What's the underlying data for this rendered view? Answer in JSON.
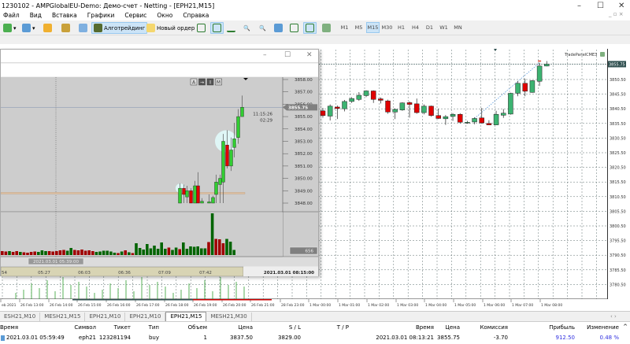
{
  "window": {
    "title": "1230102 - AMPGlobalEU-Demo: Демо-счет - Netting - [EPH21,M15]"
  },
  "menu": [
    "Файл",
    "Вид",
    "Вставка",
    "Графики",
    "Сервис",
    "Окно",
    "Справка"
  ],
  "toolbar": {
    "algo_label": "Алготрейдинг",
    "new_order_label": "Новый ордер",
    "notif_count": "1",
    "timeframes": [
      "M1",
      "M5",
      "M15",
      "M30",
      "H1",
      "H4",
      "D1",
      "W1",
      "MN"
    ],
    "active_tf": "M15"
  },
  "colors": {
    "bull": "#3cb371",
    "bear": "#e00000",
    "mini_bull": "#32cd32",
    "grid": "#5f6f6f",
    "accent": "#cce4f7"
  },
  "main_chart": {
    "type": "candlestick",
    "label": "TradePanelCME3",
    "current_price": "3855.75",
    "price_ticks": [
      "3850.50",
      "3845.50",
      "3840.50",
      "3835.50",
      "3830.50",
      "3825.50",
      "3820.50",
      "3815.50",
      "3810.50",
      "3805.50",
      "3800.50",
      "3795.50",
      "3790.50",
      "3785.50",
      "3780.50"
    ],
    "time_ticks": [
      "eb 2021",
      "26 Feb 13:00",
      "26 Feb 14:00",
      "26 Feb 15:00",
      "26 Feb 16:00",
      "26 Feb 17:00",
      "26 Feb 18:00",
      "26 Feb 19:00",
      "26 Feb 20:00",
      "26 Feb 21:00",
      "28 Feb 23:00",
      "1 Mar 00:00",
      "1 Mar 01:00",
      "1 Mar 02:00",
      "1 Mar 03:00",
      "1 Mar 04:00",
      "1 Mar 05:00",
      "1 Mar 06:00",
      "1 Mar 07:00",
      "1 Mar 08:00"
    ],
    "ohlc": [
      [
        3839.8,
        3840.8,
        3837.5,
        3838.2
      ],
      [
        3838,
        3842,
        3836.5,
        3841.4
      ],
      [
        3841.1,
        3841.6,
        3837,
        3840.6
      ],
      [
        3840.5,
        3843.5,
        3839.6,
        3843
      ],
      [
        3843,
        3844.5,
        3842.5,
        3844
      ],
      [
        3843.7,
        3846.2,
        3843.2,
        3845.1
      ],
      [
        3845,
        3846.8,
        3844.5,
        3846.6
      ],
      [
        3846.6,
        3846.8,
        3842.5,
        3843.7
      ],
      [
        3843.9,
        3844.4,
        3842.3,
        3843.4
      ],
      [
        3843.2,
        3843.6,
        3838.8,
        3839.4
      ],
      [
        3839.4,
        3840.6,
        3837,
        3840.3
      ],
      [
        3840.1,
        3842.7,
        3839.8,
        3842.5
      ],
      [
        3842.6,
        3843,
        3837.5,
        3842
      ],
      [
        3842.2,
        3844,
        3838.8,
        3839.2
      ],
      [
        3839.2,
        3842,
        3838.6,
        3841.4
      ],
      [
        3841.4,
        3841.6,
        3837.8,
        3838.2
      ],
      [
        3838.2,
        3840.5,
        3837,
        3837.2
      ],
      [
        3837.1,
        3838.4,
        3835,
        3837.8
      ],
      [
        3837.9,
        3839,
        3836.4,
        3838.6
      ],
      [
        3838.6,
        3839,
        3835.5,
        3835.9
      ],
      [
        3835.9,
        3836.4,
        3835.4,
        3835.9
      ],
      [
        3836,
        3837.6,
        3835.2,
        3837.2
      ],
      [
        3837.4,
        3840.8,
        3835.4,
        3835.7
      ],
      [
        3835.5,
        3836.6,
        3834.9,
        3835
      ],
      [
        3835,
        3839.8,
        3834.9,
        3838.6
      ],
      [
        3838.3,
        3840.4,
        3837.4,
        3839
      ],
      [
        3838.7,
        3846,
        3838.5,
        3845.8
      ],
      [
        3845.8,
        3850,
        3844.8,
        3849.2
      ],
      [
        3849.2,
        3850.8,
        3844.8,
        3846.5
      ],
      [
        3846.1,
        3850.3,
        3846,
        3850.1
      ],
      [
        3849.9,
        3856.2,
        3848.3,
        3855.1
      ],
      [
        3855.1,
        3856.8,
        3855,
        3855.75
      ]
    ]
  },
  "mini_chart": {
    "price_ticks": [
      "3858.00",
      "3857.00",
      "3856.00",
      "3855.00",
      "3854.00",
      "3853.00",
      "3852.00",
      "3851.00",
      "3850.00",
      "3849.00",
      "3848.00"
    ],
    "current_price": "3855.75",
    "countdown_time": "11:15:26",
    "countdown_left": "02:29",
    "volume_label": "656",
    "crosshair_time": "2021.03.01 05:39:00",
    "time_ticks": [
      "54",
      "05:27",
      "06:03",
      "06:36",
      "07:09",
      "07:42"
    ],
    "end_time": "2021.03.01 08:15:00",
    "buttons": [
      "A",
      "→",
      "I",
      "M"
    ],
    "ohlc": [
      [
        3848,
        3849.6,
        3848,
        3849.2
      ],
      [
        3849.2,
        3849.5,
        3848,
        3848.7
      ],
      [
        3848.5,
        3849.4,
        3848,
        3849
      ],
      [
        3849,
        3849.2,
        3848,
        3848
      ],
      [
        3848,
        3849.8,
        3848,
        3849.4
      ],
      [
        3849.4,
        3850.5,
        3848,
        3848
      ],
      [
        3848,
        3848.4,
        3848,
        3848.15
      ],
      [
        3848,
        3848.7,
        3848,
        3848.1
      ],
      [
        3848,
        3848.6,
        3848,
        3848.45
      ],
      [
        3848.7,
        3850.3,
        3848,
        3849.7
      ],
      [
        3849.5,
        3850.3,
        3848,
        3850
      ],
      [
        3849.7,
        3853.6,
        3848,
        3853
      ],
      [
        3852.7,
        3853.9,
        3850.8,
        3851
      ],
      [
        3851,
        3853.3,
        3850.6,
        3852.3
      ],
      [
        3852.5,
        3854.5,
        3851.7,
        3853.2
      ],
      [
        3853.3,
        3855.6,
        3852.8,
        3855
      ],
      [
        3855,
        3856.7,
        3855,
        3855.75
      ]
    ],
    "volumes": [
      [
        10,
        0
      ],
      [
        9,
        0
      ],
      [
        10,
        1
      ],
      [
        8,
        0
      ],
      [
        10,
        0
      ],
      [
        8,
        1
      ],
      [
        7,
        0
      ],
      [
        6,
        0
      ],
      [
        8,
        0
      ],
      [
        9,
        0
      ],
      [
        8,
        1
      ],
      [
        12,
        1
      ],
      [
        10,
        1
      ],
      [
        10,
        0
      ],
      [
        9,
        0
      ],
      [
        10,
        0
      ],
      [
        12,
        0
      ],
      [
        13,
        0
      ],
      [
        11,
        1
      ],
      [
        18,
        1
      ],
      [
        13,
        0
      ],
      [
        12,
        0
      ],
      [
        14,
        0
      ],
      [
        11,
        0
      ],
      [
        12,
        0
      ],
      [
        10,
        0
      ],
      [
        8,
        1
      ],
      [
        9,
        1
      ],
      [
        11,
        1
      ],
      [
        11,
        1
      ],
      [
        9,
        1
      ],
      [
        6,
        1
      ],
      [
        5,
        0
      ],
      [
        9,
        1
      ],
      [
        12,
        0
      ],
      [
        7,
        1
      ],
      [
        5,
        0
      ],
      [
        30,
        1
      ],
      [
        18,
        1
      ],
      [
        14,
        1
      ],
      [
        28,
        1
      ],
      [
        17,
        1
      ],
      [
        24,
        1
      ],
      [
        16,
        1
      ],
      [
        32,
        1
      ],
      [
        16,
        1
      ],
      [
        19,
        0
      ],
      [
        13,
        1
      ],
      [
        19,
        1
      ],
      [
        15,
        0
      ],
      [
        32,
        1
      ],
      [
        16,
        1
      ],
      [
        22,
        1
      ],
      [
        21,
        1
      ],
      [
        22,
        1
      ],
      [
        17,
        1
      ],
      [
        17,
        1
      ],
      [
        33,
        0
      ],
      [
        106,
        1
      ],
      [
        41,
        0
      ],
      [
        40,
        0
      ],
      [
        30,
        0
      ],
      [
        41,
        1
      ],
      [
        34,
        1
      ],
      [
        13,
        1
      ]
    ]
  },
  "bottom_tabs": [
    "ESH21,M10",
    "MESH21,M15",
    "EPH21,M10",
    "EPH21,M10",
    "EPH21,M15",
    "MESH21,M30"
  ],
  "active_tab": "EPH21,M15",
  "positions": {
    "headers": [
      "Время",
      "Символ",
      "Тикет",
      "Тип",
      "Объем",
      "Цена",
      "S / L",
      "T / P",
      "Время",
      "Цена",
      "Комиссия",
      "Прибыль",
      "Изменение"
    ],
    "rows": [
      [
        "2021.03.01 05:59:49",
        "eph21",
        "123281194",
        "buy",
        "1",
        "3837.50",
        "3829.00",
        "",
        "2021.03.01 08:13:21",
        "3855.75",
        "-3.70",
        "912.50",
        "0.48 %"
      ]
    ]
  }
}
